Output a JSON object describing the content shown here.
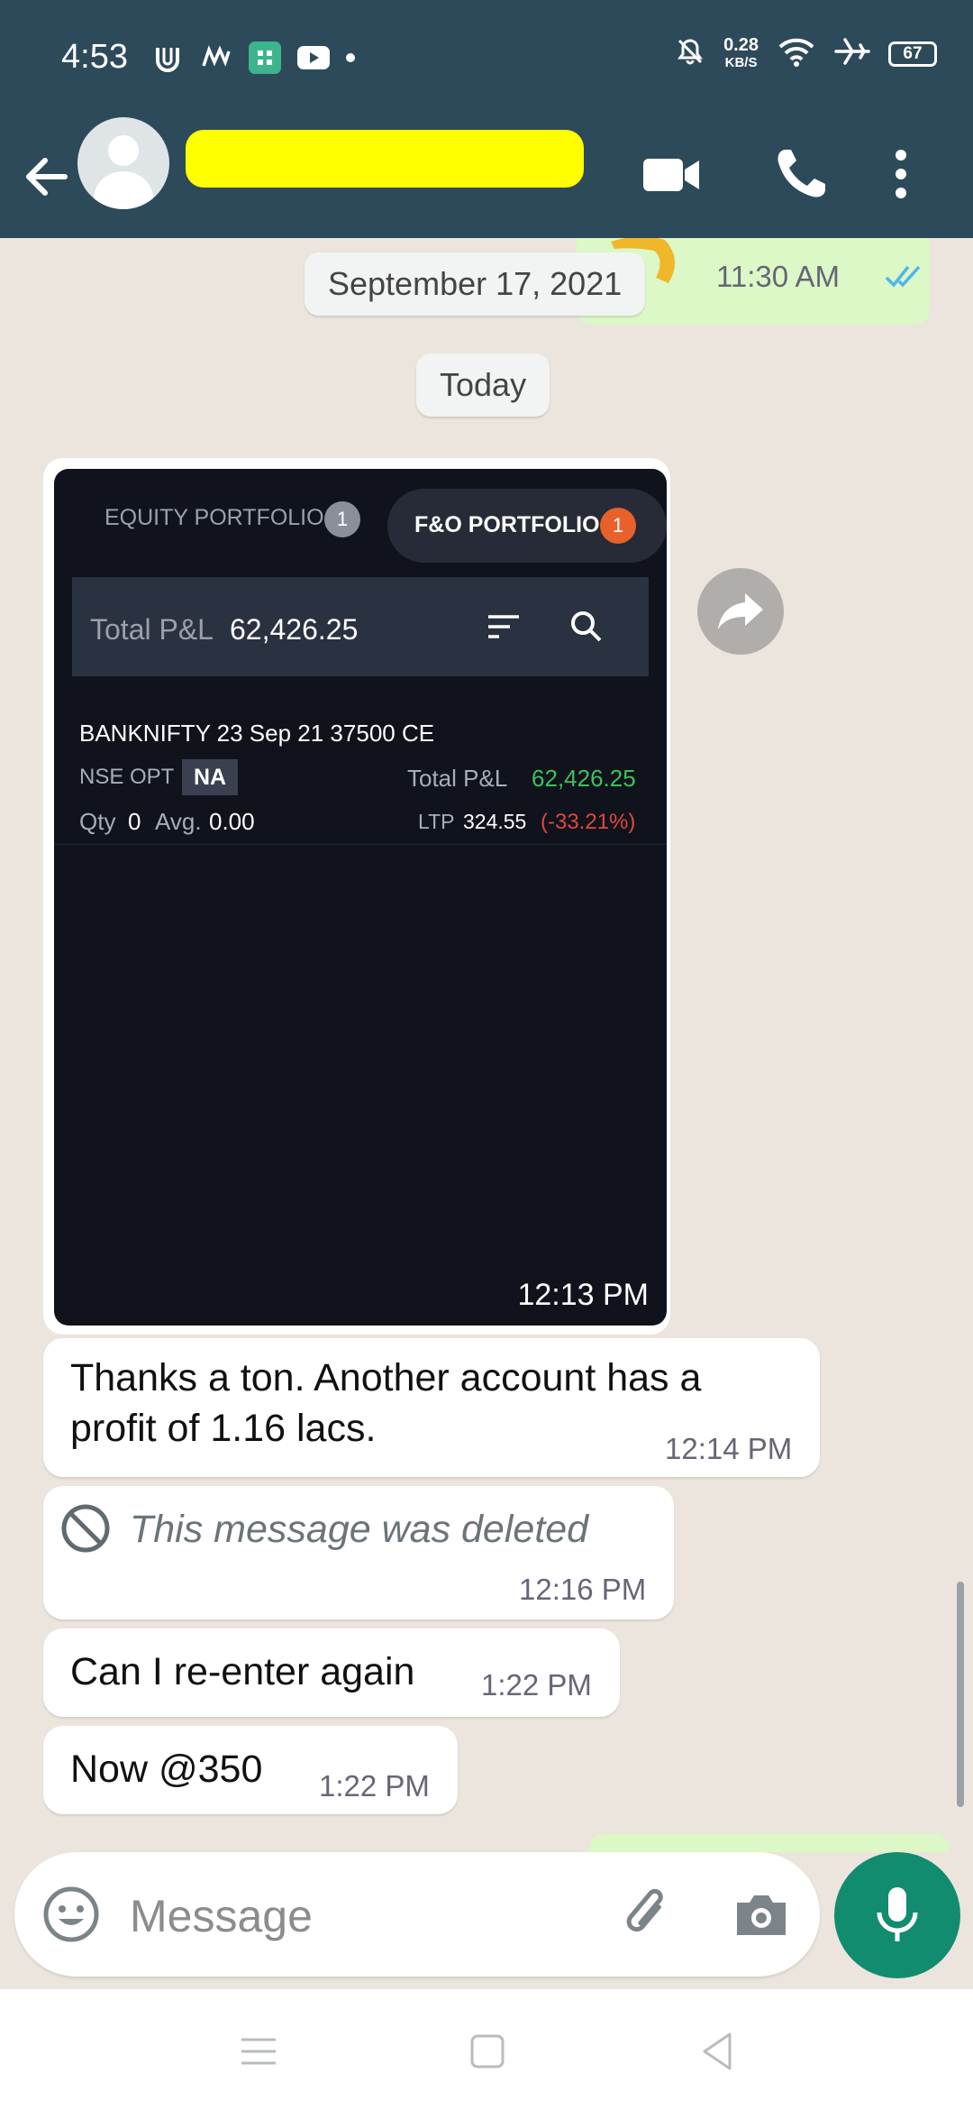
{
  "status_bar": {
    "time": "4:53",
    "net_speed_value": "0.28",
    "net_speed_unit": "KB/S",
    "battery": "67"
  },
  "header": {
    "contact_name": "",
    "icons": [
      "back-arrow-icon",
      "video-call-icon",
      "voice-call-icon",
      "more-options-icon"
    ]
  },
  "chat": {
    "prev_time": "11:30 AM",
    "date_old": "September 17, 2021",
    "date_today": "Today",
    "image_message": {
      "tab_equity": "EQUITY PORTFOLIO",
      "tab_equity_count": "1",
      "tab_fo": "F&O PORTFOLIO",
      "tab_fo_count": "1",
      "total_pl_label": "Total P&L",
      "total_pl_value": "62,426.25",
      "instrument": "BANKNIFTY 23 Sep 21 37500 CE",
      "exchange": "NSE",
      "segment": "OPT",
      "tag": "NA",
      "row_pl_label": "Total P&L",
      "row_pl_value": "62,426.25",
      "qty_label": "Qty",
      "qty_value": "0",
      "avg_label": "Avg.",
      "avg_value": "0.00",
      "ltp_label": "LTP",
      "ltp_value": "324.55",
      "ltp_change": "(-33.21%)",
      "time": "12:13 PM"
    },
    "messages": [
      {
        "text": "Thanks a ton. Another account has a profit of 1.16 lacs.",
        "time": "12:14 PM"
      },
      {
        "text": "This message was deleted",
        "time": "12:16 PM"
      },
      {
        "text": "Can I re-enter again",
        "time": "1:22 PM"
      },
      {
        "text": "Now @350",
        "time": "1:22 PM"
      }
    ]
  },
  "input": {
    "placeholder": "Message"
  },
  "colors": {
    "header_bg": "#2d4a5a",
    "chat_bg": "#ece5dd",
    "accent_green": "#128c6e",
    "outgoing_bubble": "#dcf8c6"
  }
}
